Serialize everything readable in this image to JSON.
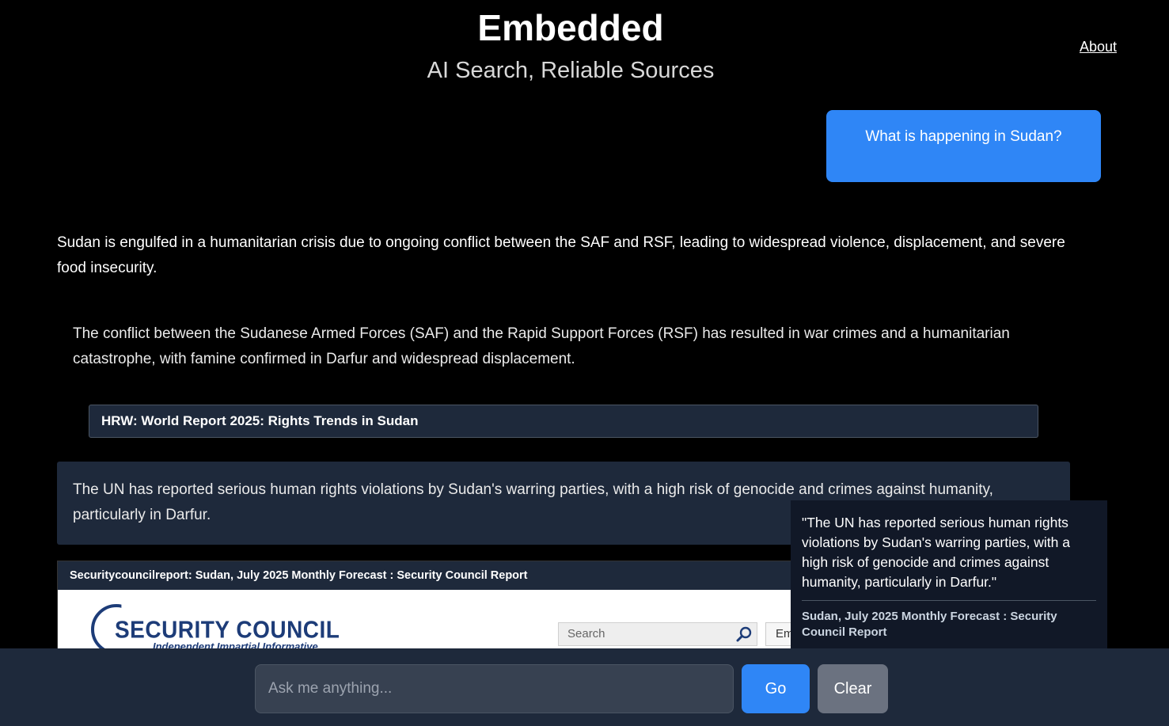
{
  "header": {
    "title": "Embedded",
    "subtitle": "AI Search, Reliable Sources",
    "about_label": "About"
  },
  "chat": {
    "user_question": "What is happening in Sudan?",
    "summary": "Sudan is engulfed in a humanitarian crisis due to ongoing conflict between the SAF and RSF, leading to widespread violence, displacement, and severe food insecurity.",
    "claims": [
      {
        "text": "The conflict between the Sudanese Armed Forces (SAF) and the Rapid Support Forces (RSF) has resulted in war crimes and a humanitarian catastrophe, with famine confirmed in Darfur and widespread displacement.",
        "source": "HRW: World Report 2025: Rights Trends in Sudan"
      },
      {
        "text": "The UN has reported serious human rights violations by Sudan's warring parties, with a high risk of genocide and crimes against humanity, particularly in Darfur.",
        "source": "Securitycouncilreport: Sudan, July 2025 Monthly Forecast : Security Council Report"
      }
    ]
  },
  "preview": {
    "logo_text": "SECURITY COUNCIL REPORT",
    "tagline": "Independent Impartial Informative",
    "search_placeholder": "Search",
    "em_label": "Em"
  },
  "tooltip": {
    "quote": "\"The UN has reported serious human rights violations by Sudan's warring parties, with a high risk of genocide and crimes against humanity, particularly in Darfur.\"",
    "source": "Sudan, July 2025 Monthly Forecast : Security Council Report"
  },
  "input_bar": {
    "placeholder": "Ask me anything...",
    "go_label": "Go",
    "clear_label": "Clear"
  },
  "colors": {
    "accent": "#2f86f6",
    "card_bg": "#1e293b",
    "tooltip_bg": "#111827",
    "clear_bg": "#6b7280",
    "logo_blue": "#1d3c78"
  },
  "icons": {
    "search": "search-icon"
  }
}
